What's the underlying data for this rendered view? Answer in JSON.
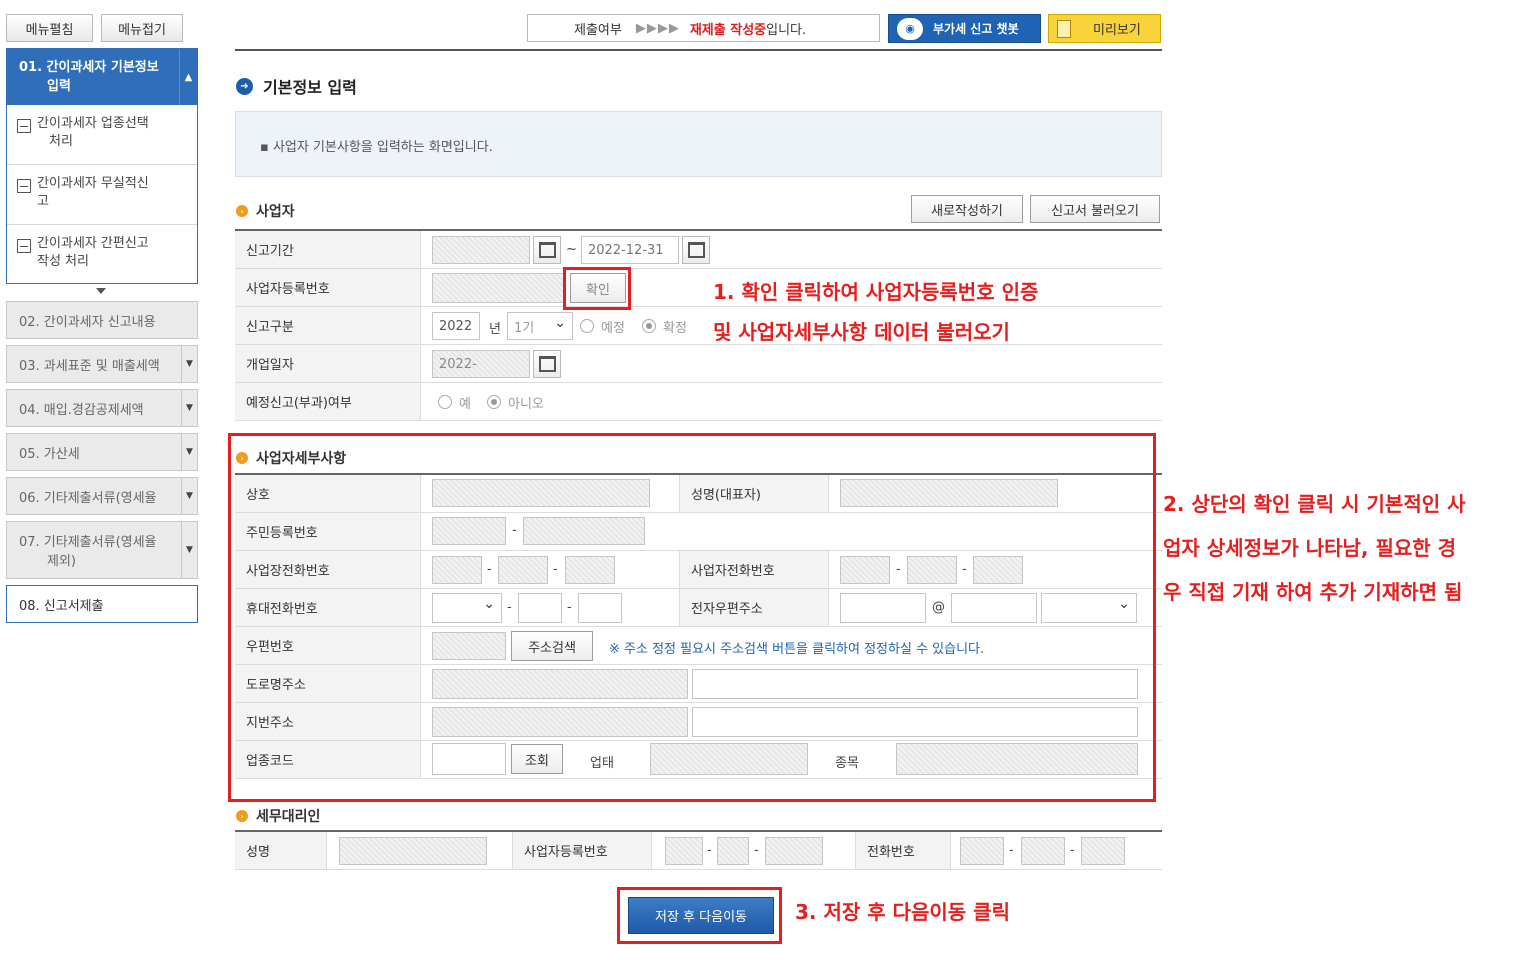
{
  "sidebar": {
    "expand_all": "메뉴펼침",
    "collapse_all": "메뉴접기",
    "step1": {
      "title_line1": "01. 간이과세자 기본정보",
      "title_line2": "입력",
      "items": [
        {
          "line1": "간이과세자 업종선택",
          "line2": "처리"
        },
        {
          "line1": "간이과세자 무실적신",
          "line2": "고"
        },
        {
          "line1": "간이과세자 간편신고",
          "line2": "작성 처리"
        }
      ]
    },
    "steps": [
      {
        "line1": "02. 간이과세자 신고내용",
        "line2": ""
      },
      {
        "line1": "03. 과세표준 및 매출세액",
        "line2": ""
      },
      {
        "line1": "04. 매입.경감공제세액",
        "line2": ""
      },
      {
        "line1": "05. 가산세",
        "line2": ""
      },
      {
        "line1": "06. 기타제출서류(영세율",
        "line2": ""
      },
      {
        "line1": "07. 기타제출서류(영세율",
        "line2": "제외)"
      },
      {
        "line1": "08. 신고서제출",
        "line2": ""
      }
    ]
  },
  "topbar": {
    "status_label": "제출여부",
    "status_arrows": "▶▶▶▶",
    "status_highlight": "재제출 작성중",
    "status_suffix": "입니다.",
    "chatbot_label": "부가세 신고 챗봇",
    "preview_label": "미리보기"
  },
  "main": {
    "title": "기본정보 입력",
    "info_text": "▪ 사업자 기본사항을 입력하는 화면입니다.",
    "section_business": "사업자",
    "btn_new": "새로작성하기",
    "btn_load": "신고서 불러오기",
    "period": {
      "label": "신고기간",
      "from": "",
      "tilde": "~",
      "to": "2022-12-31"
    },
    "reg_no": {
      "label": "사업자등록번호",
      "confirm": "확인"
    },
    "report_type": {
      "label": "신고구분",
      "year": "2022",
      "year_unit": "년",
      "term": "1기",
      "opt1": "예정",
      "opt2": "확정"
    },
    "open_date": {
      "label": "개업일자",
      "value": "2022-"
    },
    "prelim": {
      "label": "예정신고(부과)여부",
      "opt1": "예",
      "opt2": "아니오"
    },
    "section_detail": "사업자세부사항",
    "detail": {
      "trade_name": "상호",
      "rep_name": "성명(대표자)",
      "resident_no": "주민등록번호",
      "dash": "-",
      "biz_phone": "사업장전화번호",
      "owner_phone": "사업자전화번호",
      "mobile": "휴대전화번호",
      "email": "전자우편주소",
      "at": "@",
      "zip": "우편번호",
      "addr_search": "주소검색",
      "addr_note": "※ 주소 정정 필요시 주소검색 버튼을 클릭하여 정정하실 수 있습니다.",
      "road_addr": "도로명주소",
      "lot_addr": "지번주소",
      "industry_code": "업종코드",
      "lookup": "조회",
      "biz_type": "업태",
      "biz_item": "종목"
    },
    "section_agent": "세무대리인",
    "agent": {
      "name": "성명",
      "reg_no": "사업자등록번호",
      "phone": "전화번호"
    },
    "save_next": "저장 후 다음이동"
  },
  "annotations": {
    "a1_line1": "1. 확인 클릭하여 사업자등록번호 인증",
    "a1_line2": "및 사업자세부사항 데이터 불러오기",
    "a2_line1": "2. 상단의 확인 클릭 시 기본적인 사",
    "a2_line2": "업자 상세정보가 나타남, 필요한 경",
    "a2_line3": "우 직접 기재 하여 추가 기재하면 됨",
    "a3": "3. 저장 후 다음이동 클릭"
  },
  "colors": {
    "accent": "#2f6eb8",
    "annotation_red": "#e41f1f",
    "preview_yellow": "#f8d43a"
  }
}
